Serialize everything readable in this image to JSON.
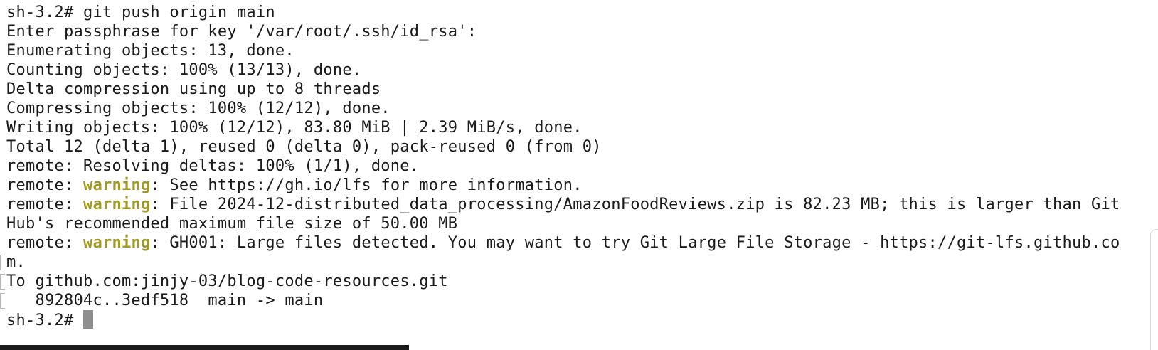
{
  "terminal": {
    "prompt": "sh-3.2#",
    "lines": {
      "l0": "sh-3.2# git push origin main",
      "l1": "Enter passphrase for key '/var/root/.ssh/id_rsa':",
      "l2": "Enumerating objects: 13, done.",
      "l3": "Counting objects: 100% (13/13), done.",
      "l4": "Delta compression using up to 8 threads",
      "l5": "Compressing objects: 100% (12/12), done.",
      "l6": "Writing objects: 100% (12/12), 83.80 MiB | 2.39 MiB/s, done.",
      "l7": "Total 12 (delta 1), reused 0 (delta 0), pack-reused 0 (from 0)",
      "l8": "remote: Resolving deltas: 100% (1/1), done.",
      "l9": {
        "prefix": "remote: ",
        "warn": "warning",
        "rest": ": See https://gh.io/lfs for more information."
      },
      "l10": {
        "prefix": "remote: ",
        "warn": "warning",
        "rest": ": File 2024-12-distributed_data_processing/AmazonFoodReviews.zip is 82.23 MB; this is larger than Git"
      },
      "l11": "Hub's recommended maximum file size of 50.00 MB",
      "l12": {
        "prefix": "remote: ",
        "warn": "warning",
        "rest": ": GH001: Large files detected. You may want to try Git Large File Storage - https://git-lfs.github.co"
      },
      "l13": "m.",
      "l14": "To github.com:jinjy-03/blog-code-resources.git",
      "l15": "   892804c..3edf518  main -> main",
      "l16": "sh-3.2# "
    }
  }
}
